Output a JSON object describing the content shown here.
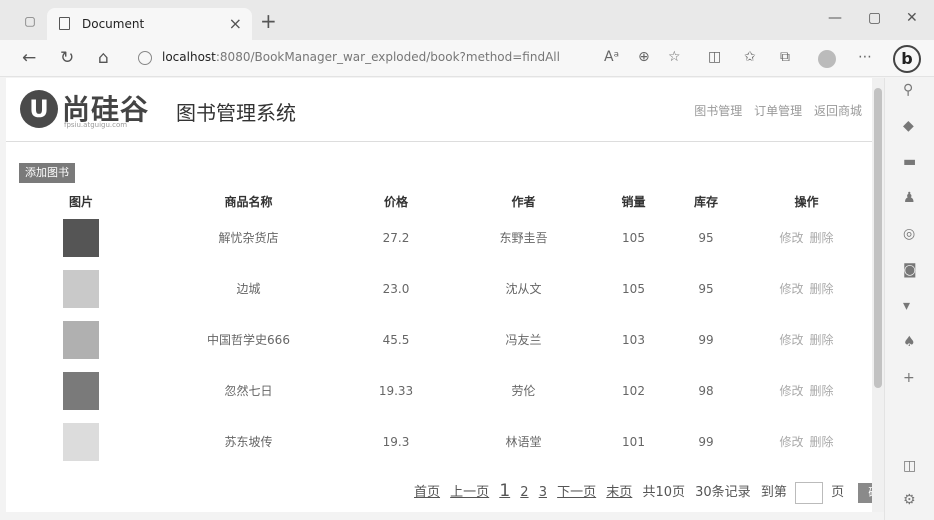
{
  "browser": {
    "tab_title": "Document",
    "url_host": "localhost",
    "url_rest": ":8080/BookManager_war_exploded/book?method=findAll",
    "toolbar_icons": [
      "read-aloud-icon",
      "zoom-icon",
      "favorite-icon",
      "split-screen-icon",
      "favorites-icon",
      "collections-icon",
      "profile-icon",
      "more-icon"
    ],
    "bing_label": "b"
  },
  "sidebar_icons": [
    "search-icon",
    "tag-icon",
    "toolbox-icon",
    "people-icon",
    "office-icon",
    "outlook-icon",
    "shopping-icon",
    "games-icon",
    "add-icon",
    "sidebar-toggle-icon",
    "settings-icon"
  ],
  "header": {
    "logo_mark": "U",
    "logo_text": "尚硅谷",
    "logo_sub": "fpsiu.atguigu.com",
    "system_title": "图书管理系统",
    "links": [
      "图书管理",
      "订单管理",
      "返回商城"
    ]
  },
  "add_button": "添加图书",
  "table": {
    "columns": [
      "图片",
      "商品名称",
      "价格",
      "作者",
      "销量",
      "库存",
      "操作"
    ],
    "rows": [
      {
        "name": "解忧杂货店",
        "price": "27.2",
        "author": "东野圭吾",
        "sales": "105",
        "stock": "95",
        "img_color": "#555555"
      },
      {
        "name": "边城",
        "price": "23.0",
        "author": "沈从文",
        "sales": "105",
        "stock": "95",
        "img_color": "#c9c9c9"
      },
      {
        "name": "中国哲学史666",
        "price": "45.5",
        "author": "冯友兰",
        "sales": "103",
        "stock": "99",
        "img_color": "#b0b0b0"
      },
      {
        "name": "忽然七日",
        "price": "19.33",
        "author": "劳伦",
        "sales": "102",
        "stock": "98",
        "img_color": "#7a7a7a"
      },
      {
        "name": "苏东坡传",
        "price": "19.3",
        "author": "林语堂",
        "sales": "101",
        "stock": "99",
        "img_color": "#dcdcdc"
      }
    ],
    "edit_label": "修改",
    "delete_label": "删除"
  },
  "pager": {
    "first": "首页",
    "prev": "上一页",
    "pages": [
      "1",
      "2",
      "3"
    ],
    "next": "下一页",
    "last": "末页",
    "total_pages": "共10页",
    "total_records": "30条记录",
    "goto_label": "到第",
    "page_suffix": "页",
    "confirm": "确定"
  }
}
